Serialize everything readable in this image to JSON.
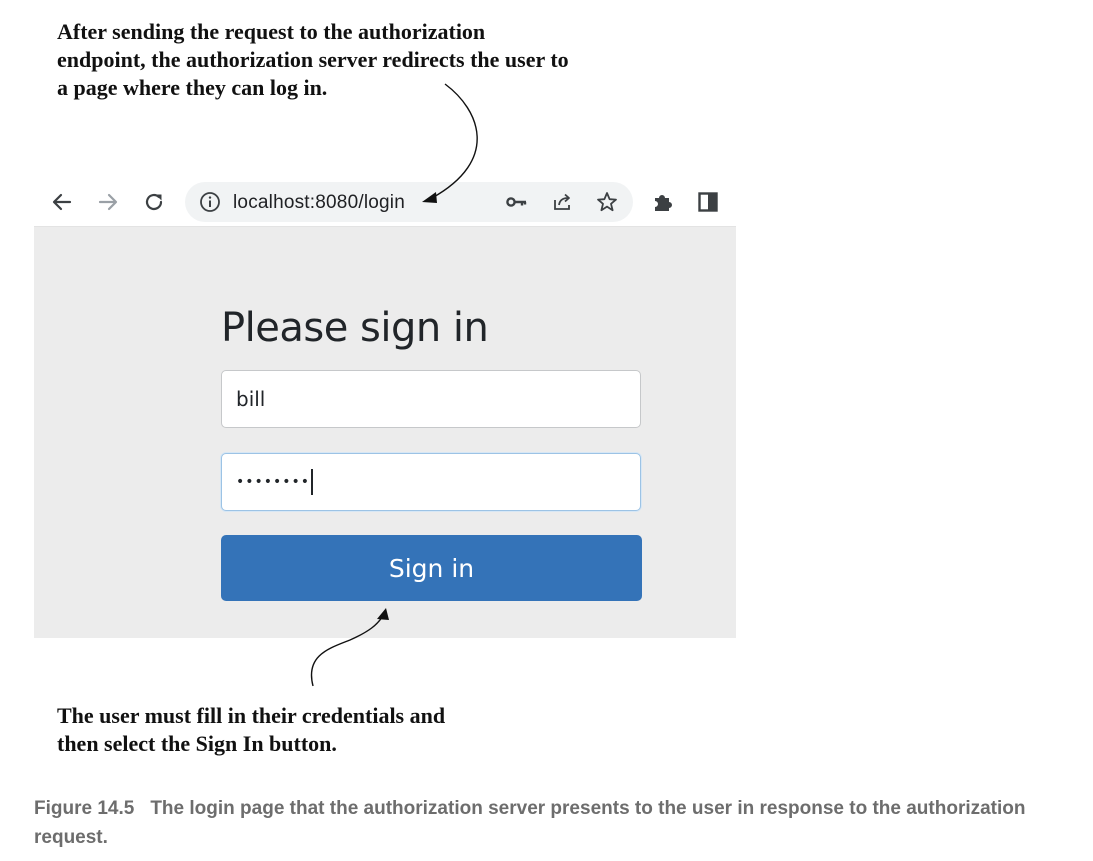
{
  "annotations": {
    "top": "After sending the request to the authorization endpoint, the authorization server redirects the user to a page where they can log in.",
    "bottom": "The user must fill in their credentials and then select the Sign In button."
  },
  "browser": {
    "url": "localhost:8080/login",
    "icons": {
      "back": "arrow-left-icon",
      "forward": "arrow-right-icon",
      "reload": "reload-icon",
      "info": "info-icon",
      "key": "key-icon",
      "share": "share-icon",
      "bookmark": "star-icon",
      "extensions": "puzzle-icon",
      "side_panel": "side-panel-icon"
    }
  },
  "login_form": {
    "heading": "Please sign in",
    "username_value": "bill",
    "password_mask": "••••••••",
    "submit_label": "Sign in",
    "button_color": "#3473b8",
    "page_background": "#ececec"
  },
  "caption": {
    "label": "Figure 14.5",
    "text": "The login page that the authorization server presents to the user in response to the authorization request."
  }
}
